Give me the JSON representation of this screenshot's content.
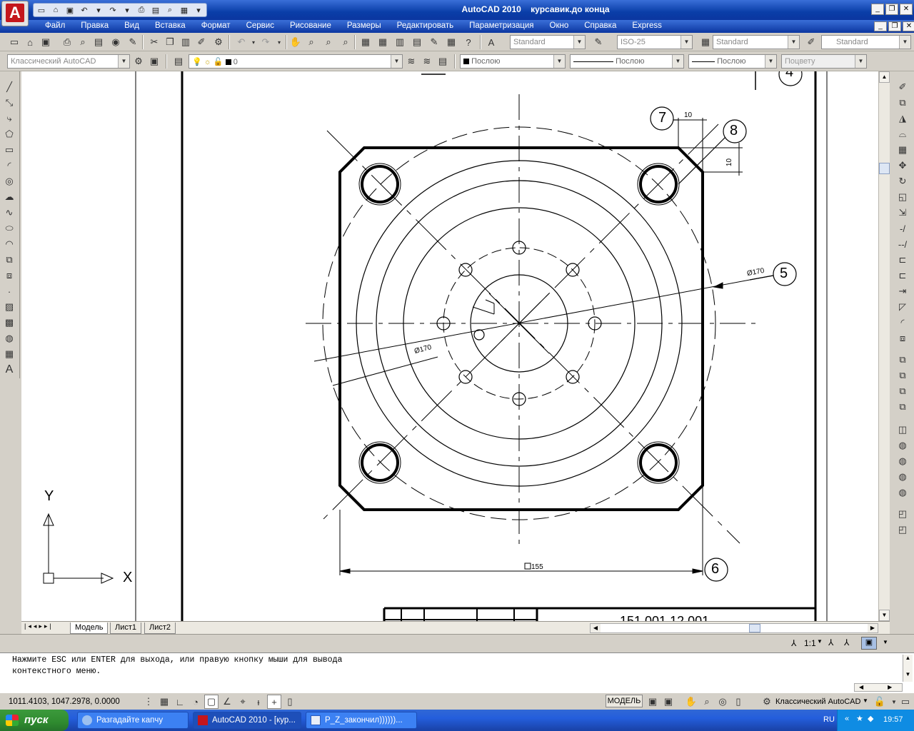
{
  "titlebar": {
    "app": "AutoCAD 2010",
    "file": "курсавик.до конца"
  },
  "menubar": [
    "Файл",
    "Правка",
    "Вид",
    "Вставка",
    "Формат",
    "Сервис",
    "Рисование",
    "Размеры",
    "Редактировать",
    "Параметризация",
    "Окно",
    "Справка",
    "Express"
  ],
  "toolbar2": {
    "text_style": "Standard",
    "dim_style": "ISO-25",
    "table_style": "Standard",
    "multileader_style": "Standard"
  },
  "toolbar3": {
    "workspace": "Классический AutoCAD",
    "layer": "0",
    "color": "Послою",
    "linetype": "Послою",
    "lineweight": "Послою",
    "plotstyle": "Поцвету"
  },
  "drawing": {
    "leaders": [
      "7",
      "8",
      "5",
      "6",
      "4"
    ],
    "dims": {
      "d10a": "10",
      "d10b": "10",
      "d170a": "Ø170",
      "d170b": "Ø170",
      "d155": "155"
    },
    "title_block_text": "151.001.12.001",
    "ucs": {
      "y": "Y",
      "x": "X"
    }
  },
  "tabs": [
    "Модель",
    "Лист1",
    "Лист2"
  ],
  "annotation_scale": "1:1",
  "command": {
    "line1": "Нажмите ESC или ENTER для выхода, или правую кнопку мыши для вывода",
    "line2": "контекстного меню."
  },
  "status": {
    "coords": "1011.4103, 1047.2978, 0.0000",
    "model": "МОДЕЛЬ",
    "workspace": "Классический AutoCAD"
  },
  "taskbar": {
    "start": "пуск",
    "tasks": [
      "Разгадайте капчу",
      "AutoCAD 2010 - [кур...",
      "P_Z_закончил))))))..."
    ],
    "lang": "RU",
    "time": "19:57"
  }
}
